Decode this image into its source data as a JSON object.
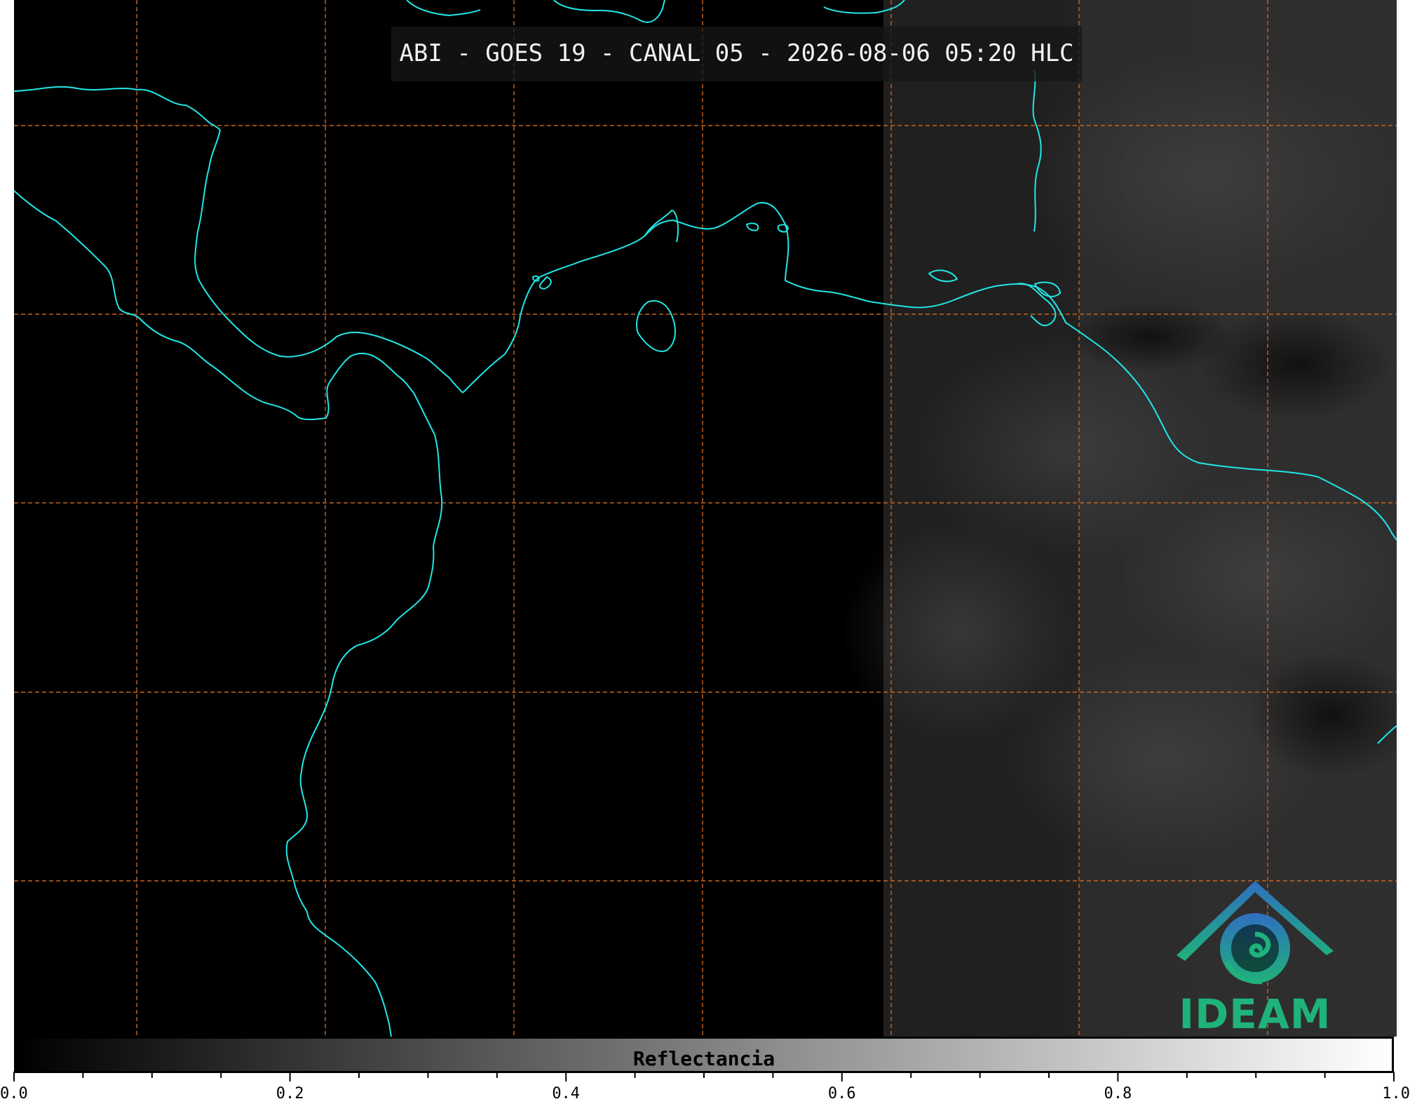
{
  "map": {
    "title": "ABI - GOES 19 - CANAL 05 - 2026-08-06 05:20 HLC",
    "coastline_color": "#22e6e6",
    "grid_color": "#c86420",
    "background_color": "#000000",
    "grid_lines": {
      "vertical_count": 7,
      "horizontal_count": 5,
      "style": "dashed"
    }
  },
  "logo": {
    "text": "IDEAM",
    "icon": "ideam-mountain-swirl-icon",
    "color": "#1fb27a"
  },
  "colorbar": {
    "label": "Reflectancia",
    "min": 0.0,
    "max": 1.0,
    "gradient": [
      "#000000",
      "#ffffff"
    ],
    "tick_labels": [
      "0.0",
      "0.2",
      "0.4",
      "0.6",
      "0.8",
      "1.0"
    ],
    "minor_tick_step": 0.05
  }
}
